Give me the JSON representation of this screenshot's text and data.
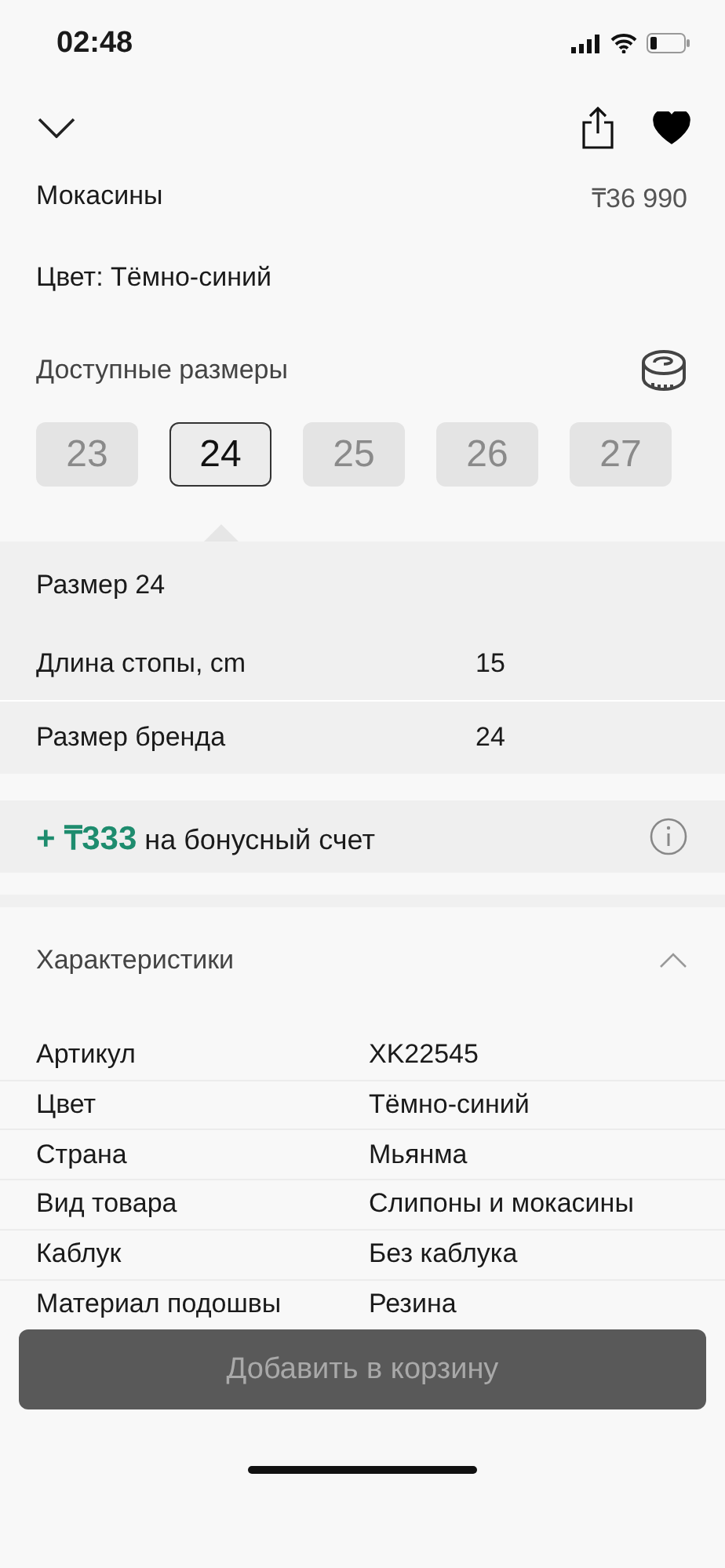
{
  "status_bar": {
    "time": "02:48"
  },
  "nav": {
    "favorite": true
  },
  "product": {
    "name": "Мокасины",
    "price": "₸36 990",
    "color_label": "Цвет: Тёмно-синий"
  },
  "sizes": {
    "title": "Доступные размеры",
    "items": [
      {
        "label": "23",
        "selected": false
      },
      {
        "label": "24",
        "selected": true
      },
      {
        "label": "25",
        "selected": false
      },
      {
        "label": "26",
        "selected": false
      },
      {
        "label": "27",
        "selected": false
      }
    ]
  },
  "size_details": {
    "title": "Размер  24",
    "rows": [
      {
        "label": "Длина стопы, cm",
        "value": "15"
      },
      {
        "label": "Размер бренда",
        "value": "24"
      }
    ]
  },
  "bonus": {
    "amount": "+ ₸333",
    "text": "на бонусный счет"
  },
  "characteristics": {
    "title": "Характеристики",
    "expanded": true,
    "rows": [
      {
        "label": "Артикул",
        "value": "XK22545"
      },
      {
        "label": "Цвет",
        "value": "Тёмно-синий"
      },
      {
        "label": "Страна",
        "value": "Мьянма"
      },
      {
        "label": "Вид товара",
        "value": "Слипоны и мокасины"
      },
      {
        "label": "Каблук",
        "value": "Без каблука"
      },
      {
        "label": "Материал подошвы",
        "value": "Резина"
      }
    ]
  },
  "add_button": {
    "label": "Добавить в корзину",
    "disabled": true
  }
}
